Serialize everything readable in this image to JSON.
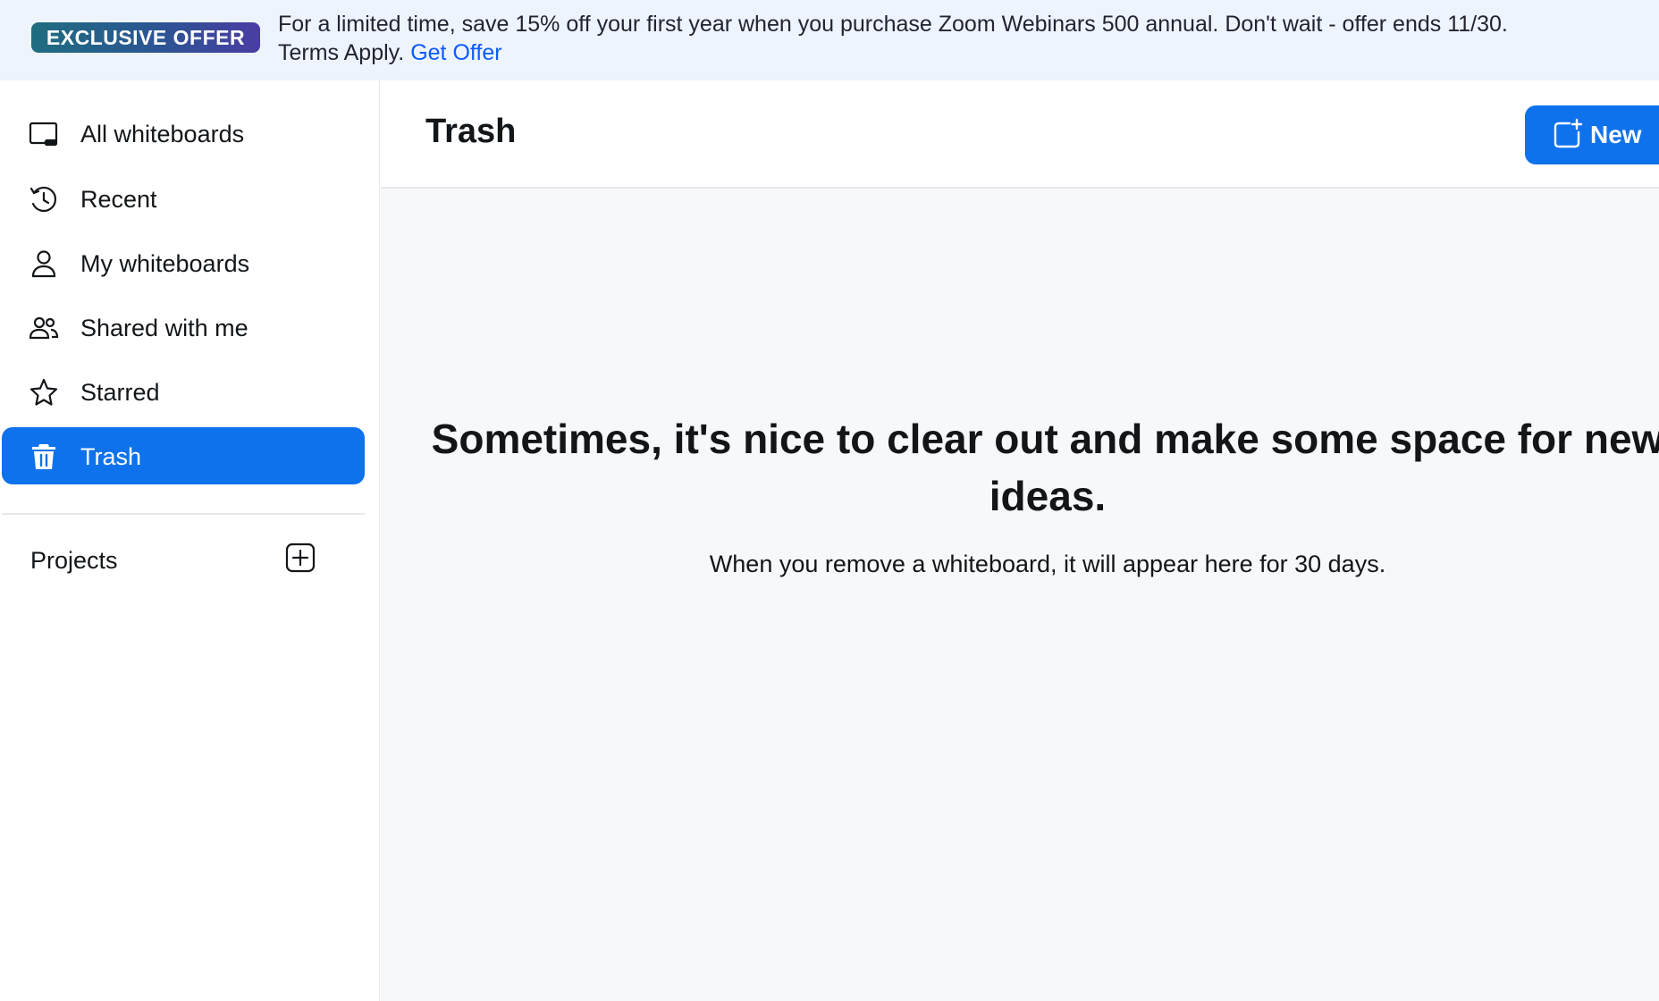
{
  "banner": {
    "badge": "EXCLUSIVE OFFER",
    "message_line1": "For a limited time, save 15% off your first year when you purchase Zoom Webinars 500 annual. Don't wait - offer ends 11/30.",
    "message_line2": "Terms Apply.",
    "link": "Get Offer"
  },
  "sidebar": {
    "items": [
      {
        "label": "All whiteboards",
        "icon": "whiteboard-icon"
      },
      {
        "label": "Recent",
        "icon": "clock-icon"
      },
      {
        "label": "My whiteboards",
        "icon": "person-icon"
      },
      {
        "label": "Shared with me",
        "icon": "people-icon"
      },
      {
        "label": "Starred",
        "icon": "star-icon"
      },
      {
        "label": "Trash",
        "icon": "trash-icon",
        "active": true
      }
    ],
    "projects_label": "Projects"
  },
  "header": {
    "title": "Trash",
    "new_button": "New"
  },
  "empty_state": {
    "title_line1": "Sometimes, it's nice to clear out and make some space for new",
    "title_line2": "ideas.",
    "subtitle": "When you remove a whiteboard, it will appear here for 30 days."
  },
  "colors": {
    "accent": "#0e72ed",
    "link": "#0b5cff",
    "banner_bg": "#eef4fc",
    "content_bg": "#f7f8fa"
  }
}
